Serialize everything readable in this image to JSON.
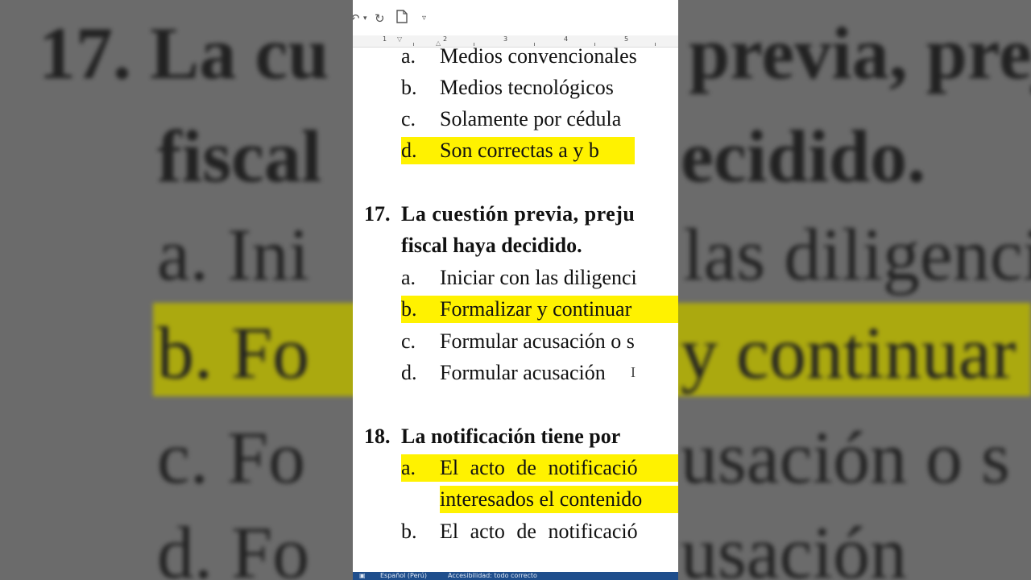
{
  "background": {
    "q17_line1": "17. La cu",
    "q17_line1_right": "previa, preju",
    "q17_line2": "fiscal",
    "q17_line2_right": "ecidido.",
    "opt_a": "a.   Ini",
    "opt_a_right": "las diligenci",
    "opt_b": "b.   Fo",
    "opt_b_right": "y continuar",
    "opt_c": "c.   Fo",
    "opt_c_right": "usación o s",
    "opt_d": "d.   Fo",
    "opt_d_right": "usación"
  },
  "ruler": {
    "n1": "1",
    "n2": "2",
    "n3": "3",
    "n4": "4",
    "n5": "5"
  },
  "icons": {
    "undo": "undo-icon",
    "redo": "redo-icon",
    "document": "document-icon",
    "customize": "customize-qat-icon"
  },
  "document": {
    "q16_options": [
      {
        "letter": "a.",
        "text": "Medios convencionales"
      },
      {
        "letter": "b.",
        "text": "Medios tecnológicos"
      },
      {
        "letter": "c.",
        "text": "Solamente por cédula"
      },
      {
        "letter": "d.",
        "text": "Son correctas a y b"
      }
    ],
    "q17": {
      "number": "17.",
      "line1": "La cuestión previa, preju",
      "line2": "fiscal haya decidido.",
      "options": [
        {
          "letter": "a.",
          "text": "Iniciar con las diligenci"
        },
        {
          "letter": "b.",
          "text": "Formalizar y continuar"
        },
        {
          "letter": "c.",
          "text": "Formular acusación o s"
        },
        {
          "letter": "d.",
          "text": "Formular acusación"
        }
      ]
    },
    "q18": {
      "number": "18.",
      "line1": "La notificación tiene por",
      "options": [
        {
          "letter": "a.",
          "text": "El acto de notificació",
          "text2": "interesados el contenido"
        },
        {
          "letter": "b.",
          "text": "El acto de notificació"
        }
      ]
    }
  },
  "statusbar": {
    "language": "Español (Perú)",
    "accessibility": "Accesibilidad: todo correcto"
  },
  "colors": {
    "highlight": "#fff200",
    "statusbar": "#1f4e8c"
  }
}
